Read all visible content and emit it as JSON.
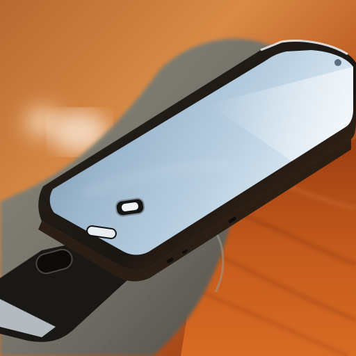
{
  "scene": {
    "colors": {
      "table_light": "#e08a3c",
      "table_mid": "#b8541c",
      "table_dark": "#7a2e0e",
      "table_highlight": "#f3b780",
      "light_glow": "#fff3e6",
      "under_device_body": "#7f7d70",
      "under_device_shadow": "#55534a",
      "phone_frame": "#15130f",
      "phone_frame_edge": "#3a2a1c",
      "screen_light": "#dbe8f2",
      "screen_mid": "#a9c3d8",
      "screen_dark": "#5f7890",
      "screen_glare": "#f4f8fb",
      "button_fill": "#1a1a1a",
      "button_highlight": "#f0f4f8"
    }
  }
}
